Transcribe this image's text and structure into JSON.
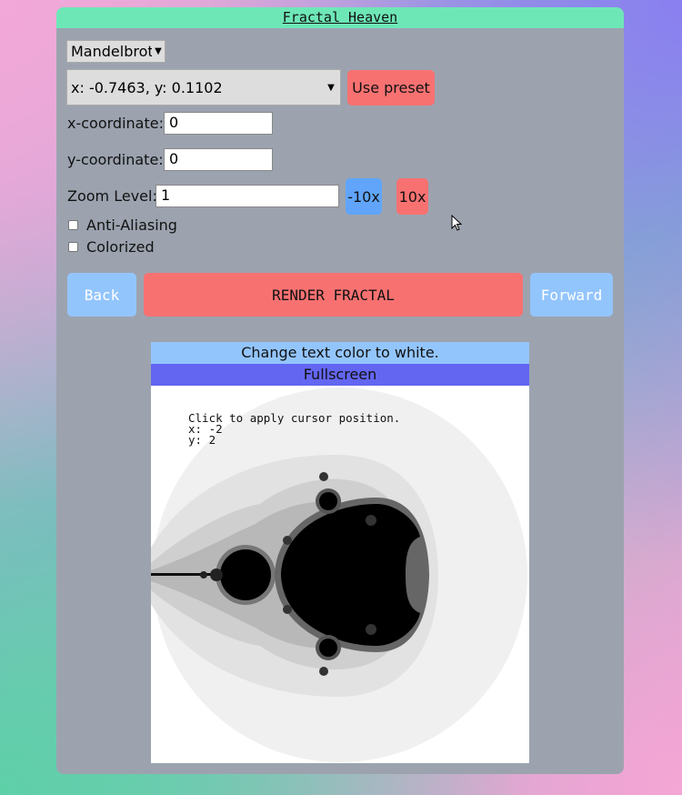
{
  "app": {
    "title": "Fractal Heaven"
  },
  "controls": {
    "fractal_type": "Mandelbrot",
    "preset": "x: -0.7463, y: 0.1102",
    "use_preset_label": "Use preset",
    "x_label": "x-coordinate:",
    "x_value": "0",
    "y_label": "y-coordinate:",
    "y_value": "0",
    "zoom_label": "Zoom Level:",
    "zoom_value": "1",
    "zoom_out_label": "-10x",
    "zoom_in_label": "10x",
    "anti_aliasing_label": "Anti-Aliasing",
    "anti_aliasing_checked": false,
    "colorized_label": "Colorized",
    "colorized_checked": false
  },
  "nav": {
    "back_label": "Back",
    "render_label": "RENDER FRACTAL",
    "forward_label": "Forward"
  },
  "canvas": {
    "text_color_toggle": "Change text color to white.",
    "fullscreen_label": "Fullscreen",
    "cursor_hint": "Click to apply cursor position.",
    "cursor_x": "x: -2",
    "cursor_y": "y: 2"
  },
  "colors": {
    "panel": "#9ca3af",
    "title_bar": "#6ee7b7",
    "red_button": "#f87171",
    "blue_button": "#60a5fa",
    "light_blue": "#93c5fd",
    "indigo": "#6366f1"
  }
}
